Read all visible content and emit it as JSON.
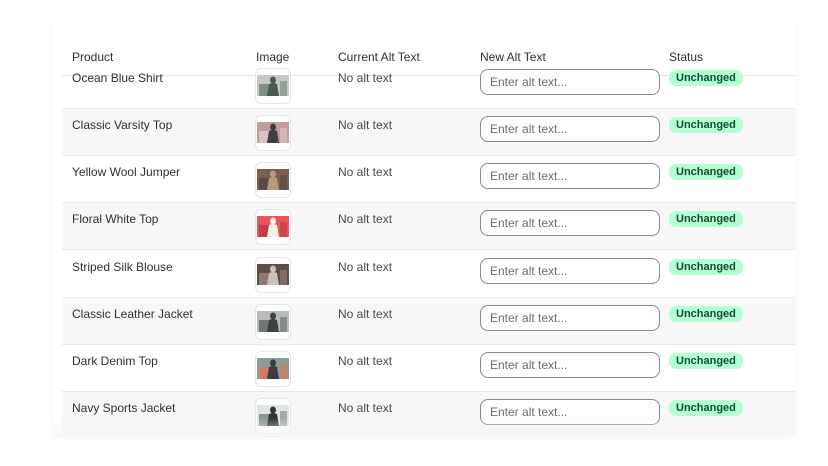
{
  "table": {
    "columns": {
      "product": "Product",
      "image": "Image",
      "current_alt": "Current Alt Text",
      "new_alt": "New Alt Text",
      "status": "Status"
    },
    "placeholder": "Enter alt text...",
    "rows": [
      {
        "product": "Ocean Blue Shirt",
        "current_alt": "No alt text",
        "status": "Unchanged",
        "thumb": {
          "bg": "#c9c9c4",
          "fg": "#4a5a52",
          "accent": "#7f8f88"
        }
      },
      {
        "product": "Classic Varsity Top",
        "current_alt": "No alt text",
        "status": "Unchanged",
        "thumb": {
          "bg": "#c79a9c",
          "fg": "#3f3f42",
          "accent": "#d8c3c0"
        }
      },
      {
        "product": "Yellow Wool Jumper",
        "current_alt": "No alt text",
        "status": "Unchanged",
        "thumb": {
          "bg": "#7a5e52",
          "fg": "#b89a7d",
          "accent": "#5a4a44"
        }
      },
      {
        "product": "Floral White Top",
        "current_alt": "No alt text",
        "status": "Unchanged",
        "thumb": {
          "bg": "#e4575a",
          "fg": "#f3f0ea",
          "accent": "#c23f45"
        }
      },
      {
        "product": "Striped Silk Blouse",
        "current_alt": "No alt text",
        "status": "Unchanged",
        "thumb": {
          "bg": "#5d4c48",
          "fg": "#c9c3bd",
          "accent": "#8e7b73"
        }
      },
      {
        "product": "Classic Leather Jacket",
        "current_alt": "No alt text",
        "status": "Unchanged",
        "thumb": {
          "bg": "#b7bcb8",
          "fg": "#3d4140",
          "accent": "#707774"
        }
      },
      {
        "product": "Dark Denim Top",
        "current_alt": "No alt text",
        "status": "Unchanged",
        "thumb": {
          "bg": "#8c9c98",
          "fg": "#3c3a44",
          "accent": "#d47a5e"
        }
      },
      {
        "product": "Navy Sports Jacket",
        "current_alt": "No alt text",
        "status": "Unchanged",
        "thumb": {
          "bg": "#dfe5e2",
          "fg": "#2f3432",
          "accent": "#8a9490"
        }
      }
    ]
  },
  "colors": {
    "status_badge_bg": "#b4fed2",
    "status_badge_text": "#0c5132",
    "row_alt_bg": "#f7f7f7"
  }
}
